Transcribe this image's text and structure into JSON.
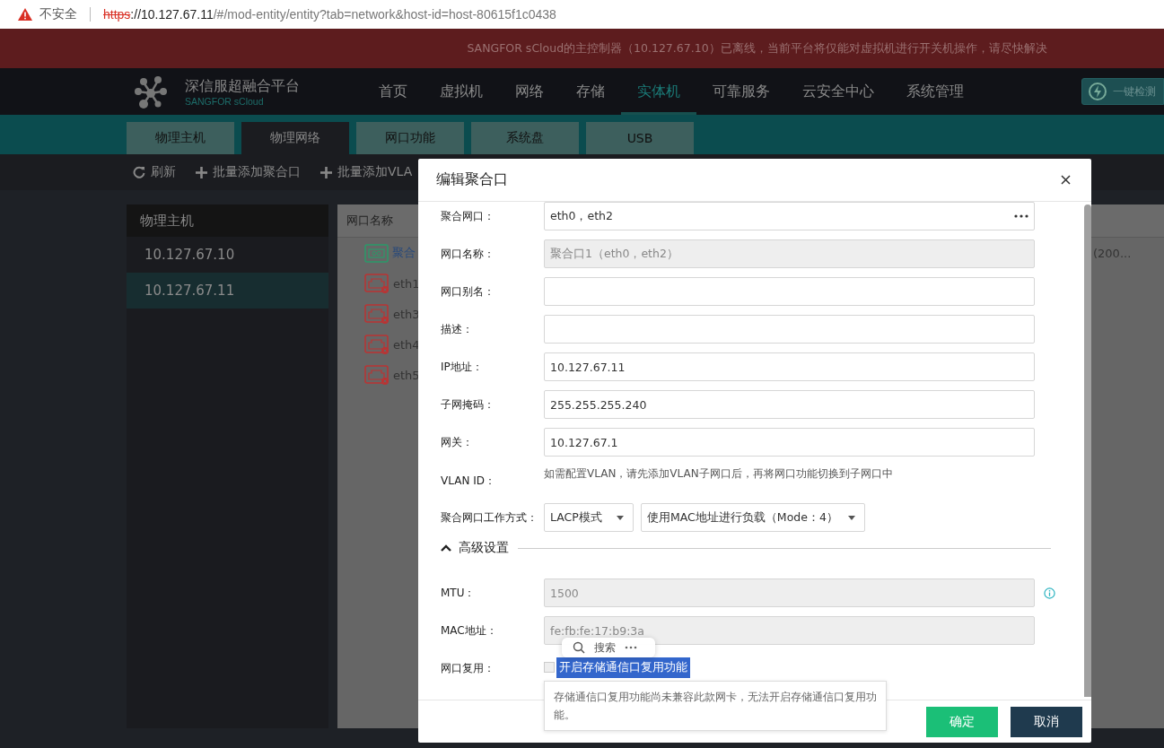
{
  "browser": {
    "security_label": "不安全",
    "url_scheme": "https",
    "url_host": "://10.127.67.11",
    "url_path": "/#/mod-entity/entity?tab=network&host-id=host-80615f1c0438"
  },
  "banner": {
    "text": "SANGFOR sCloud的主控制器（10.127.67.10）已离线，当前平台将仅能对虚拟机进行开关机操作，请尽快解决"
  },
  "header": {
    "brand_title": "深信服超融合平台",
    "brand_subtitle": "SANGFOR sCloud",
    "nav": [
      {
        "label": "首页",
        "selected": false
      },
      {
        "label": "虚拟机",
        "selected": false
      },
      {
        "label": "网络",
        "selected": false
      },
      {
        "label": "存储",
        "selected": false
      },
      {
        "label": "实体机",
        "selected": true
      },
      {
        "label": "可靠服务",
        "selected": false
      },
      {
        "label": "云安全中心",
        "selected": false
      },
      {
        "label": "系统管理",
        "selected": false
      }
    ],
    "action_button": "一键检测"
  },
  "tabs": [
    {
      "label": "物理主机",
      "selected": false
    },
    {
      "label": "物理网络",
      "selected": true
    },
    {
      "label": "网口功能",
      "selected": false
    },
    {
      "label": "系统盘",
      "selected": false
    },
    {
      "label": "USB",
      "selected": false
    }
  ],
  "toolbar": [
    {
      "kind": "refresh",
      "label": "刷新"
    },
    {
      "kind": "add",
      "label": "批量添加聚合口"
    },
    {
      "kind": "add",
      "label": "批量添加VLA"
    }
  ],
  "host_panel": {
    "title": "物理主机",
    "hosts": [
      {
        "label": "10.127.67.10",
        "selected": false
      },
      {
        "label": "10.127.67.11",
        "selected": true
      }
    ]
  },
  "table": {
    "columns": [
      "网口名称"
    ],
    "rows": [
      {
        "name": "聚合",
        "kind": "aggregate",
        "tail": "(200..."
      },
      {
        "name": "eth1",
        "kind": "down"
      },
      {
        "name": "eth3",
        "kind": "down"
      },
      {
        "name": "eth4",
        "kind": "down"
      },
      {
        "name": "eth5",
        "kind": "down"
      }
    ]
  },
  "dialog": {
    "title": "编辑聚合口",
    "fields": [
      {
        "kind": "picker",
        "label": "聚合网口：",
        "value": "eth0，eth2"
      },
      {
        "kind": "input",
        "label": "网口名称：",
        "value": "聚合口1（eth0，eth2）",
        "disabled": true
      },
      {
        "kind": "input",
        "label": "网口别名：",
        "disabled": false
      },
      {
        "kind": "input",
        "label": "描述：",
        "disabled": false
      },
      {
        "kind": "input",
        "label": "IP地址：",
        "value": "10.127.67.11",
        "disabled": false
      },
      {
        "kind": "input",
        "label": "子网掩码：",
        "value": "255.255.255.240",
        "disabled": false
      },
      {
        "kind": "input",
        "label": "网关：",
        "value": "10.127.67.1",
        "disabled": false
      },
      {
        "kind": "note",
        "label": "VLAN ID：",
        "text": "如需配置VLAN，请先添加VLAN子网口后，再将网口功能切换到子网口中"
      },
      {
        "kind": "selects",
        "label": "聚合网口工作方式：",
        "selects": [
          "LACP模式",
          "使用MAC地址进行负载（Mode：4）"
        ]
      }
    ],
    "advanced": {
      "label": "高级设置",
      "expanded": true,
      "fields": [
        {
          "kind": "input",
          "label": "MTU：",
          "value": "1500",
          "disabled": true,
          "info": true
        },
        {
          "kind": "input",
          "label": "MAC地址：",
          "value": "fe:fb:fe:17:b9:3a",
          "disabled": true
        },
        {
          "kind": "checkbox",
          "label": "网口复用：",
          "text": "开启存储通信口复用功能",
          "checked": false,
          "text_selected": true
        }
      ]
    },
    "search_popup": {
      "label": "搜索"
    },
    "tooltip": "存储通信口复用功能尚未兼容此款网卡，无法开启存储通信口复用功能。",
    "buttons": [
      {
        "label": "确定",
        "kind": "primary"
      },
      {
        "label": "取消",
        "kind": "secondary"
      }
    ]
  }
}
